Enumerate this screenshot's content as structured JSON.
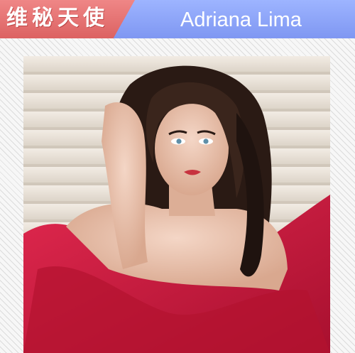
{
  "banner": {
    "cn_title": "维秘天使",
    "name": "Adriana Lima",
    "colors": {
      "left": "#e66f6f",
      "right": "#8aa2f8",
      "text": "#ffffff"
    }
  },
  "photo": {
    "subject": "Adriana Lima portrait",
    "colors": {
      "dress": "#c8173c",
      "hair": "#2a1a14",
      "backdrop": "#e8e1d8"
    }
  }
}
